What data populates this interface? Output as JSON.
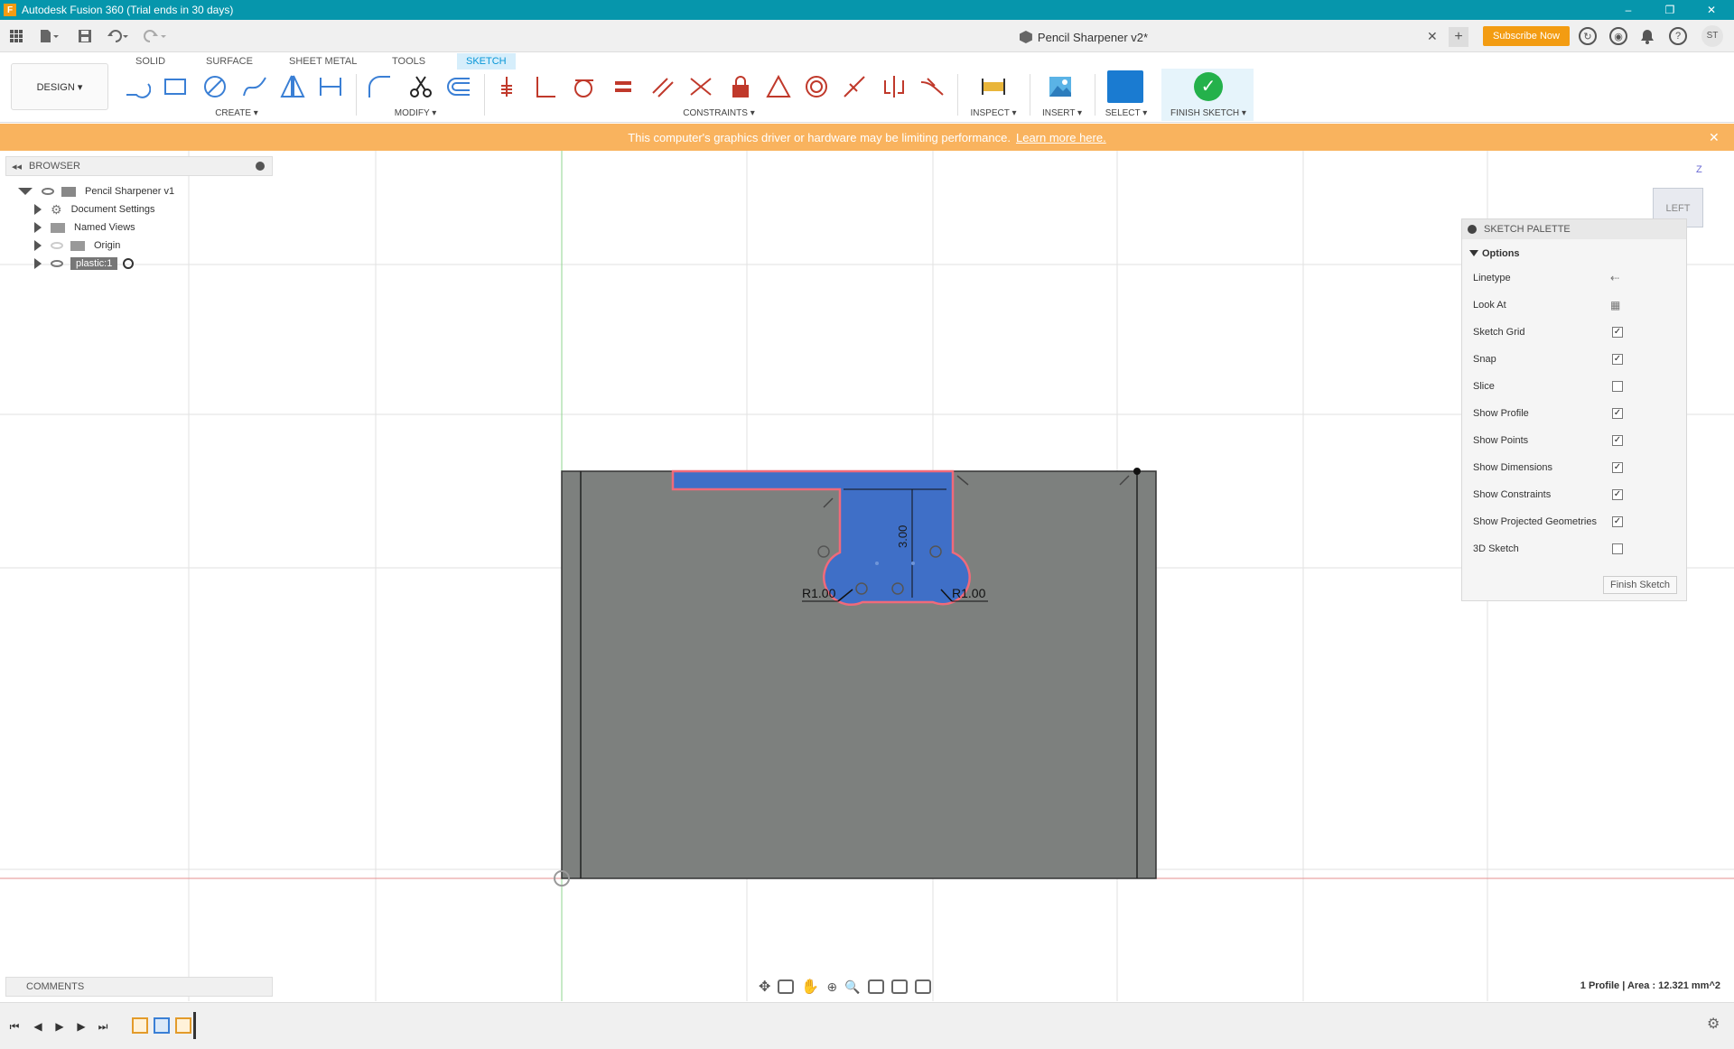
{
  "window": {
    "title": "Autodesk Fusion 360 (Trial ends in 30 days)",
    "app_icon_letter": "F",
    "controls": [
      "–",
      "❐",
      "✕"
    ]
  },
  "appbar": {
    "doc_title": "Pencil Sharpener v2*",
    "subscribe": "Subscribe Now",
    "user_initials": "ST",
    "close_glyph": "✕",
    "new_tab_glyph": "+"
  },
  "toolbar": {
    "workspace": "DESIGN ▾",
    "tabs": [
      "SOLID",
      "SURFACE",
      "SHEET METAL",
      "TOOLS",
      "SKETCH"
    ],
    "active_tab": "SKETCH",
    "groups": {
      "create": "CREATE ▾",
      "modify": "MODIFY ▾",
      "constraints": "CONSTRAINTS ▾",
      "inspect": "INSPECT ▾",
      "insert": "INSERT ▾",
      "select": "SELECT ▾",
      "finish": "FINISH SKETCH ▾"
    }
  },
  "warning": {
    "text": "This computer's graphics driver or hardware may be limiting performance.",
    "link": "Learn more here.",
    "close": "✕"
  },
  "browser": {
    "header": "BROWSER",
    "items": [
      {
        "label": "Pencil Sharpener v1"
      },
      {
        "label": "Document Settings"
      },
      {
        "label": "Named Views"
      },
      {
        "label": "Origin"
      },
      {
        "label": "plastic:1"
      }
    ]
  },
  "comments": {
    "header": "COMMENTS"
  },
  "sketch": {
    "dim_left": "R1.00",
    "dim_right": "R1.00",
    "dim_vertical": "3.00",
    "colors": {
      "body": "#7d807e",
      "profile": "#3f6fc7",
      "outline": "#f06a7a"
    }
  },
  "palette": {
    "header": "SKETCH PALETTE",
    "section": "Options",
    "rows": [
      {
        "label": "Linetype",
        "checked": null
      },
      {
        "label": "Look At",
        "checked": null
      },
      {
        "label": "Sketch Grid",
        "checked": true
      },
      {
        "label": "Snap",
        "checked": true
      },
      {
        "label": "Slice",
        "checked": false
      },
      {
        "label": "Show Profile",
        "checked": true
      },
      {
        "label": "Show Points",
        "checked": true
      },
      {
        "label": "Show Dimensions",
        "checked": true
      },
      {
        "label": "Show Constraints",
        "checked": true
      },
      {
        "label": "Show Projected Geometries",
        "checked": true
      },
      {
        "label": "3D Sketch",
        "checked": false
      }
    ],
    "finish_button": "Finish Sketch"
  },
  "viewcube": {
    "face": "LEFT",
    "axis": "Z"
  },
  "status": {
    "text": "1 Profile | Area : 12.321 mm^2"
  },
  "timeline": {
    "buttons": [
      "⏮",
      "◀",
      "▶",
      "▶",
      "⏭"
    ]
  },
  "settings": "⚙"
}
